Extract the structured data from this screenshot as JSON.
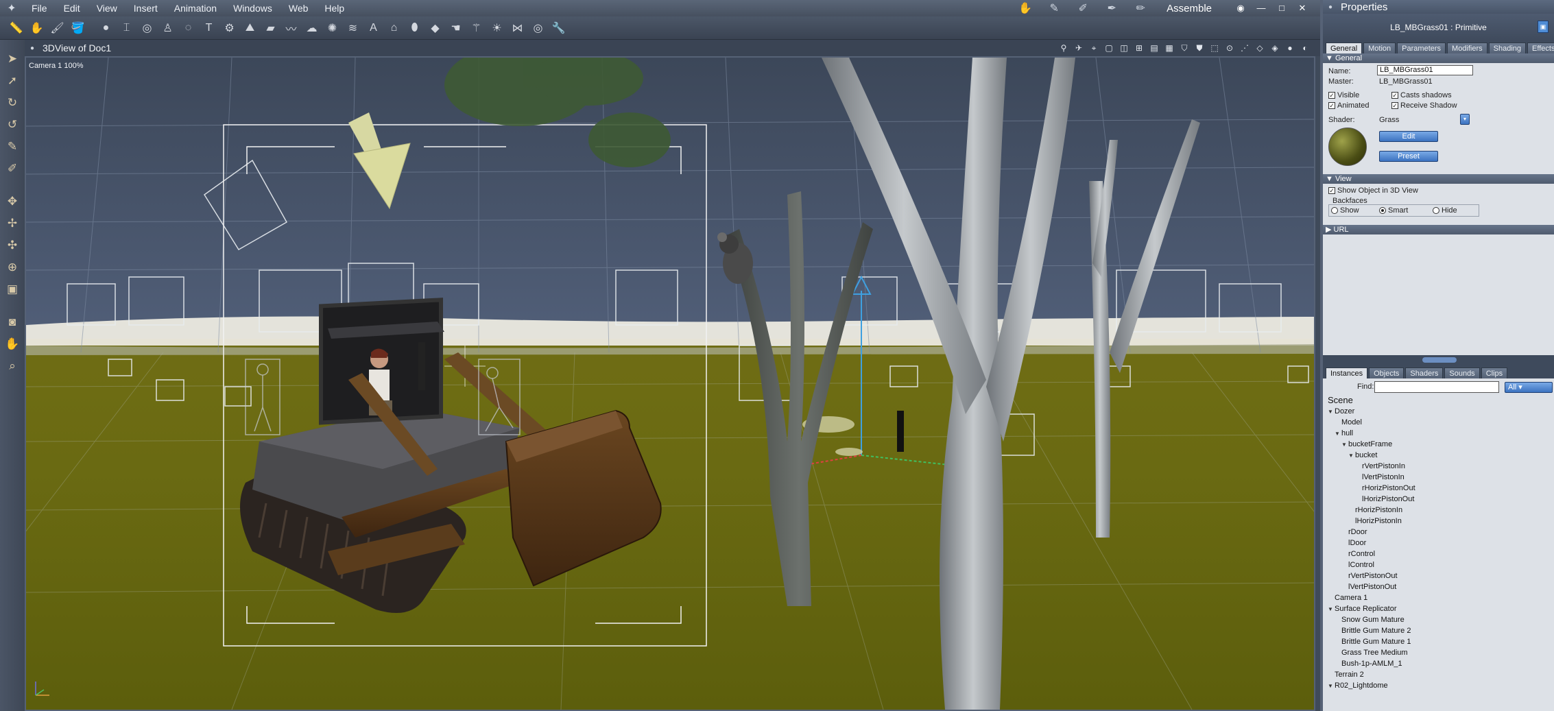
{
  "menubar": {
    "items": [
      "File",
      "Edit",
      "View",
      "Insert",
      "Animation",
      "Windows",
      "Web",
      "Help"
    ],
    "room": "Assemble"
  },
  "viewport": {
    "title": "3DView of Doc1",
    "camera_label": "Camera 1 100%"
  },
  "properties": {
    "title": "Properties",
    "object_title": "LB_MBGrass01 : Primitive",
    "tabs": [
      "General",
      "Motion",
      "Parameters",
      "Modifiers",
      "Shading",
      "Effects"
    ],
    "active_tab": "General",
    "general_section": "General",
    "name_label": "Name:",
    "name_value": "LB_MBGrass01",
    "master_label": "Master:",
    "master_value": "LB_MBGrass01",
    "visible_label": "Visible",
    "animated_label": "Animated",
    "casts_label": "Casts shadows",
    "receive_label": "Receive Shadow",
    "shader_label": "Shader:",
    "shader_value": "Grass",
    "edit_label": "Edit",
    "preset_label": "Preset",
    "view_section": "View",
    "show_object_label": "Show Object in 3D View",
    "backfaces_label": "Backfaces",
    "bf_show": "Show",
    "bf_smart": "Smart",
    "bf_hide": "Hide",
    "url_section": "URL"
  },
  "browser": {
    "tabs": [
      "Instances",
      "Objects",
      "Shaders",
      "Sounds",
      "Clips"
    ],
    "active_tab": "Instances",
    "find_label": "Find:",
    "find_value": "",
    "filter_value": "All",
    "scene_label": "Scene",
    "tree": [
      {
        "label": "Dozer",
        "level": 0,
        "open": true
      },
      {
        "label": "Model",
        "level": 1
      },
      {
        "label": "hull",
        "level": 1,
        "open": true
      },
      {
        "label": "bucketFrame",
        "level": 2,
        "open": true
      },
      {
        "label": "bucket",
        "level": 3,
        "open": true
      },
      {
        "label": "rVertPistonIn",
        "level": 4
      },
      {
        "label": "lVertPistonIn",
        "level": 4
      },
      {
        "label": "rHorizPistonOut",
        "level": 4
      },
      {
        "label": "lHorizPistonOut",
        "level": 4
      },
      {
        "label": "rHorizPistonIn",
        "level": 3
      },
      {
        "label": "lHorizPistonIn",
        "level": 3
      },
      {
        "label": "rDoor",
        "level": 2
      },
      {
        "label": "lDoor",
        "level": 2
      },
      {
        "label": "rControl",
        "level": 2
      },
      {
        "label": "lControl",
        "level": 2
      },
      {
        "label": "rVertPistonOut",
        "level": 2
      },
      {
        "label": "lVertPistonOut",
        "level": 2
      },
      {
        "label": "Camera 1",
        "level": 0
      },
      {
        "label": "Surface Replicator",
        "level": 0,
        "open": true
      },
      {
        "label": "Snow Gum Mature",
        "level": 1
      },
      {
        "label": "Brittle Gum Mature 2",
        "level": 1
      },
      {
        "label": "Brittle Gum Mature 1",
        "level": 1
      },
      {
        "label": "Grass Tree Medium",
        "level": 1
      },
      {
        "label": "Bush-1p-AMLM_1",
        "level": 1
      },
      {
        "label": "Terrain 2",
        "level": 0
      },
      {
        "label": "R02_Lightdome",
        "level": 0,
        "open": true
      }
    ]
  }
}
